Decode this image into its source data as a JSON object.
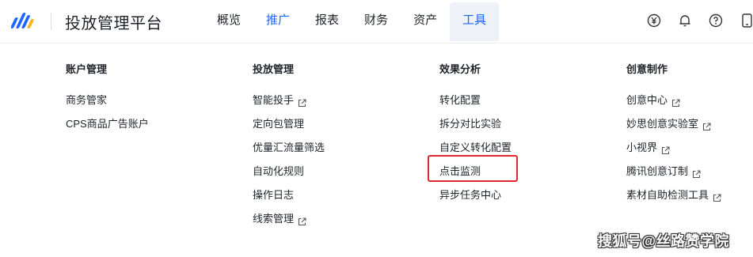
{
  "app": {
    "title": "投放管理平台"
  },
  "colors": {
    "accent": "#1a66ff",
    "highlight": "#e3262f"
  },
  "nav": [
    {
      "label": "概览",
      "state": "normal"
    },
    {
      "label": "推广",
      "state": "active"
    },
    {
      "label": "报表",
      "state": "normal"
    },
    {
      "label": "财务",
      "state": "normal"
    },
    {
      "label": "资产",
      "state": "normal"
    },
    {
      "label": "工具",
      "state": "hover"
    }
  ],
  "right_icons": [
    "yen-icon",
    "bell-icon",
    "help-icon",
    "phone-icon"
  ],
  "menu": {
    "columns": [
      {
        "title": "账户管理",
        "items": [
          {
            "label": "商务管家",
            "external": false
          },
          {
            "label": "CPS商品广告账户",
            "external": false
          }
        ]
      },
      {
        "title": "投放管理",
        "items": [
          {
            "label": "智能投手",
            "external": true
          },
          {
            "label": "定向包管理",
            "external": false
          },
          {
            "label": "优量汇流量筛选",
            "external": false
          },
          {
            "label": "自动化规则",
            "external": false
          },
          {
            "label": "操作日志",
            "external": false
          },
          {
            "label": "线索管理",
            "external": true
          }
        ]
      },
      {
        "title": "效果分析",
        "items": [
          {
            "label": "转化配置",
            "external": false
          },
          {
            "label": "拆分对比实验",
            "external": false
          },
          {
            "label": "自定义转化配置",
            "external": false
          },
          {
            "label": "点击监测",
            "external": false
          },
          {
            "label": "异步任务中心",
            "external": false
          }
        ]
      },
      {
        "title": "创意制作",
        "items": [
          {
            "label": "创意中心",
            "external": true
          },
          {
            "label": "妙思创意实验室",
            "external": true
          },
          {
            "label": "小视界",
            "external": true
          },
          {
            "label": "腾讯创意订制",
            "external": true
          },
          {
            "label": "素材自助检测工具",
            "external": true
          }
        ]
      }
    ]
  },
  "watermark": "搜狐号@丝路赞学院"
}
